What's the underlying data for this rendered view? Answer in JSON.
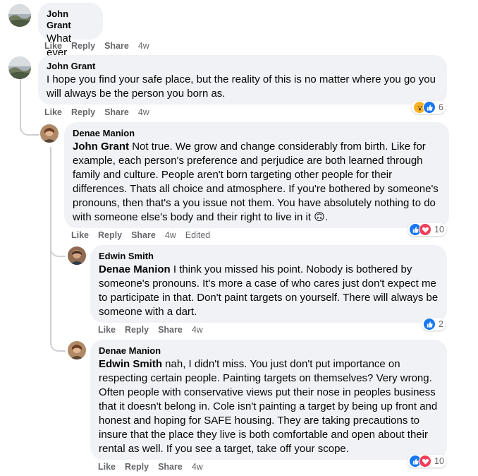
{
  "comments": [
    {
      "author": "John Grant",
      "text": "What ever",
      "actions": {
        "like": "Like",
        "reply": "Reply",
        "share": "Share",
        "time": "4w"
      }
    },
    {
      "author": "John Grant",
      "text": "I hope you find your safe place, but the reality of this is no matter where you go you will always be the person you born as.",
      "actions": {
        "like": "Like",
        "reply": "Reply",
        "share": "Share",
        "time": "4w"
      },
      "reactions": {
        "count": "6",
        "types": [
          "wow",
          "like"
        ]
      }
    },
    {
      "author": "Denae Manion",
      "mention": "John Grant",
      "text": "Not true. We grow and change considerably from birth. Like for example, each person's preference and perjudice are both learned through family and culture. People aren't born targeting other people for their differences. Thats all choice and atmosphere. If you're bothered by someone's pronouns, then that's a you issue not them. You have absolutely nothing to do with someone else's body and their right to live in it 🙃.",
      "actions": {
        "like": "Like",
        "reply": "Reply",
        "share": "Share",
        "time": "4w",
        "edited": "Edited"
      },
      "reactions": {
        "count": "10",
        "types": [
          "like",
          "love"
        ]
      }
    },
    {
      "author": "Edwin Smith",
      "mention": "Denae Manion",
      "text": "I think you missed his point. Nobody is bothered by someone's pronouns. It's more a case of who cares just don't expect me to participate in that. Don't paint targets on yourself. There will always be someone with a dart.",
      "actions": {
        "like": "Like",
        "reply": "Reply",
        "share": "Share",
        "time": "4w"
      },
      "reactions": {
        "count": "2",
        "types": [
          "like"
        ]
      }
    },
    {
      "author": "Denae Manion",
      "mention": "Edwin Smith",
      "text": "nah, I didn't miss. You just don't put importance on respecting certain people. Painting targets on themselves? Very wrong. Often people with conservative views put their nose in peoples business that it doesn't belong in. Cole isn't painting a target by being up front and honest and hoping for SAFE housing. They are taking precautions to insure that the place they live is both comfortable and open about their rental as well. If you see a target, take off your scope.",
      "actions": {
        "like": "Like",
        "reply": "Reply",
        "share": "Share",
        "time": "4w"
      },
      "reactions": {
        "count": "10",
        "types": [
          "like",
          "love"
        ]
      }
    }
  ],
  "colors": {
    "bubble": "#f0f2f5",
    "meta": "#65676b",
    "like": "#1877f2",
    "love": "#f33e58",
    "wow": "#f7b125"
  },
  "icons": {
    "like": "thumbs-up-icon",
    "love": "heart-icon",
    "wow": "wow-face-icon"
  }
}
